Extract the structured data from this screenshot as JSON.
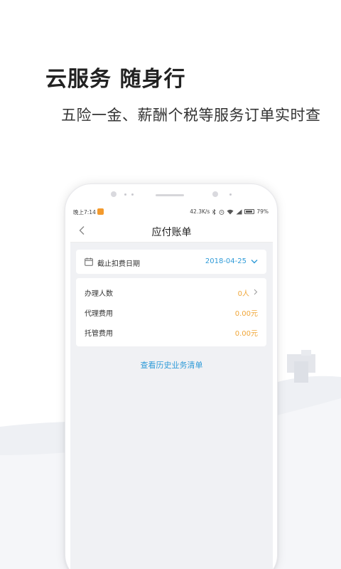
{
  "hero": {
    "title": "云服务 随身行",
    "subtitle": "五险一金、薪酬个税等服务订单实时查"
  },
  "statusbar": {
    "time": "晚上7:14",
    "speed": "42.3K/s",
    "battery": "79%"
  },
  "navbar": {
    "title": "应付账单"
  },
  "date_card": {
    "label": "截止扣费日期",
    "value": "2018-04-25"
  },
  "rows": [
    {
      "label": "办理人数",
      "value": "0人"
    },
    {
      "label": "代理费用",
      "value": "0.00元"
    },
    {
      "label": "托管费用",
      "value": "0.00元"
    }
  ],
  "history_link": "查看历史业务清单",
  "colors": {
    "accent_blue": "#2f9bd8",
    "value_orange": "#f0a73a",
    "screen_bg": "#f0f1f4"
  },
  "icons": [
    "back-icon",
    "calendar-icon",
    "chevron-down-icon",
    "chevron-right-icon",
    "battery-icon",
    "wifi-icon",
    "signal-icon",
    "alarm-icon",
    "bluetooth-icon"
  ]
}
